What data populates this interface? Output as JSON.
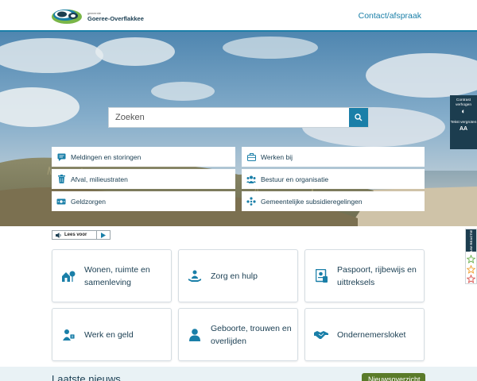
{
  "header": {
    "logo_small": "gemeente",
    "logo_text": "Goeree-Overflakkee",
    "contact_label": "Contact/afspraak"
  },
  "search": {
    "placeholder": "Zoeken",
    "icon": "search-icon"
  },
  "quick_links": [
    {
      "label": "Meldingen en storingen",
      "icon": "chat-icon"
    },
    {
      "label": "Werken bij",
      "icon": "briefcase-icon"
    },
    {
      "label": "Afval, milieustraten",
      "icon": "trash-icon"
    },
    {
      "label": "Bestuur en organisatie",
      "icon": "people-group-icon"
    },
    {
      "label": "Geldzorgen",
      "icon": "money-icon"
    },
    {
      "label": "Gemeentelijke subsidieregelingen",
      "icon": "community-icon"
    }
  ],
  "accessibility": {
    "contrast_label": "Contrast verhogen",
    "text_label": "Tekst vergroten",
    "text_icon_label": "AA"
  },
  "feedback": {
    "label": "UW REACTIE",
    "star_colors": [
      "#6ab04c",
      "#f0a030",
      "#d9534f"
    ]
  },
  "readspeaker": {
    "label": "Lees voor"
  },
  "tiles": [
    {
      "label": "Wonen, ruimte en samenleving",
      "icon": "house-tree-icon"
    },
    {
      "label": "Zorg en hulp",
      "icon": "care-hands-icon"
    },
    {
      "label": "Paspoort, rijbewijs en uittreksels",
      "icon": "passport-icon"
    },
    {
      "label": "Werk en geld",
      "icon": "work-money-icon"
    },
    {
      "label": "Geboorte, trouwen en overlijden",
      "icon": "person-icon"
    },
    {
      "label": "Ondernemersloket",
      "icon": "handshake-icon"
    }
  ],
  "news": {
    "title": "Laatste nieuws",
    "button_label": "Nieuwsoverzicht"
  },
  "colors": {
    "accent": "#1a7fa8",
    "dark": "#1c3d4f",
    "text": "#1a3e52",
    "news_button": "#5a7b2a",
    "logo_green": "#7ab648"
  }
}
